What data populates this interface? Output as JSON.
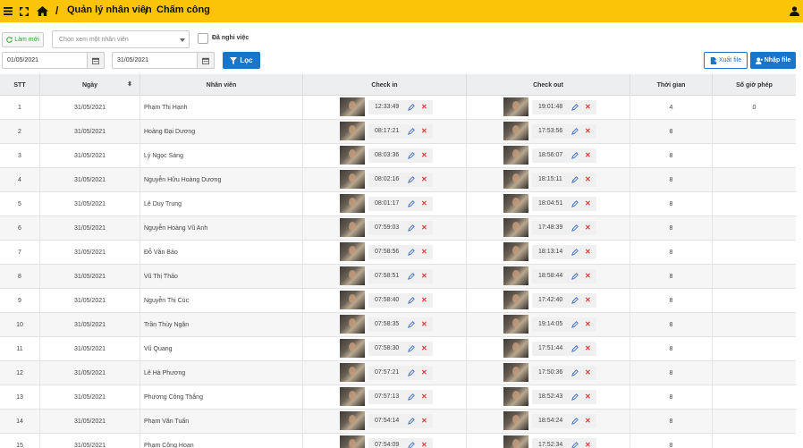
{
  "header": {
    "breadcrumb": [
      "Quản lý nhân viên",
      "Chấm công"
    ],
    "bg_color": "#fcc409"
  },
  "toolbar": {
    "refresh_label": "Làm mới",
    "employee_select_placeholder": "Chọn xem một nhân viên",
    "resigned_label": "Đã nghỉ việc",
    "from_date": "01/05/2021",
    "to_date": "31/05/2021",
    "filter_label": "Lọc",
    "export_label": "Xuất file",
    "import_label": "Nhập file",
    "accent_color": "#1a74c8"
  },
  "table": {
    "columns": [
      "STT",
      "Ngày",
      "Nhân viên",
      "Check in",
      "Check out",
      "Thời gian",
      "Số giờ phép"
    ],
    "rows": [
      {
        "stt": "1",
        "date": "31/05/2021",
        "name": "Phạm Thị Hạnh",
        "check_in": "12:33:49",
        "check_out": "19:01:48",
        "hours": "4",
        "leave": "0"
      },
      {
        "stt": "2",
        "date": "31/05/2021",
        "name": "Hoàng Đại Dương",
        "check_in": "08:17:21",
        "check_out": "17:53:56",
        "hours": "8",
        "leave": ""
      },
      {
        "stt": "3",
        "date": "31/05/2021",
        "name": "Lý Ngọc Sáng",
        "check_in": "08:03:36",
        "check_out": "18:56:07",
        "hours": "8",
        "leave": ""
      },
      {
        "stt": "4",
        "date": "31/05/2021",
        "name": "Nguyễn Hữu Hoàng Dương",
        "check_in": "08:02:16",
        "check_out": "18:15:11",
        "hours": "8",
        "leave": ""
      },
      {
        "stt": "5",
        "date": "31/05/2021",
        "name": "Lê Duy Trung",
        "check_in": "08:01:17",
        "check_out": "18:04:51",
        "hours": "8",
        "leave": ""
      },
      {
        "stt": "6",
        "date": "31/05/2021",
        "name": "Nguyễn Hoàng Vũ Anh",
        "check_in": "07:59:03",
        "check_out": "17:48:39",
        "hours": "8",
        "leave": ""
      },
      {
        "stt": "7",
        "date": "31/05/2021",
        "name": "Đỗ Văn Bảo",
        "check_in": "07:58:56",
        "check_out": "18:13:14",
        "hours": "8",
        "leave": ""
      },
      {
        "stt": "8",
        "date": "31/05/2021",
        "name": "Vũ Thị Thảo",
        "check_in": "07:58:51",
        "check_out": "18:58:44",
        "hours": "8",
        "leave": ""
      },
      {
        "stt": "9",
        "date": "31/05/2021",
        "name": "Nguyễn Thị Cúc",
        "check_in": "07:58:40",
        "check_out": "17:42:40",
        "hours": "8",
        "leave": ""
      },
      {
        "stt": "10",
        "date": "31/05/2021",
        "name": "Trần Thùy Ngân",
        "check_in": "07:58:35",
        "check_out": "19:14:05",
        "hours": "8",
        "leave": ""
      },
      {
        "stt": "11",
        "date": "31/05/2021",
        "name": "Vũ Quang",
        "check_in": "07:58:30",
        "check_out": "17:51:44",
        "hours": "8",
        "leave": ""
      },
      {
        "stt": "12",
        "date": "31/05/2021",
        "name": "Lê Hà Phương",
        "check_in": "07:57:21",
        "check_out": "17:50:36",
        "hours": "8",
        "leave": ""
      },
      {
        "stt": "13",
        "date": "31/05/2021",
        "name": "Phương Công Thắng",
        "check_in": "07:57:13",
        "check_out": "18:52:43",
        "hours": "8",
        "leave": ""
      },
      {
        "stt": "14",
        "date": "31/05/2021",
        "name": "Phạm Văn Tuấn",
        "check_in": "07:54:14",
        "check_out": "18:54:24",
        "hours": "8",
        "leave": ""
      },
      {
        "stt": "15",
        "date": "31/05/2021",
        "name": "Phạm Công Hoan",
        "check_in": "07:54:09",
        "check_out": "17:52:34",
        "hours": "8",
        "leave": ""
      }
    ]
  }
}
